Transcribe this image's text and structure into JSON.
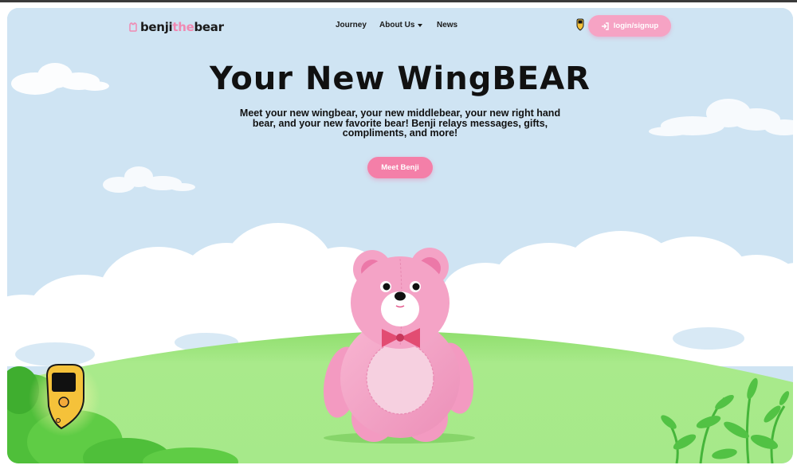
{
  "brand": {
    "logo_part1": "benji",
    "logo_part2": "the",
    "logo_part3": "bear"
  },
  "nav": {
    "items": [
      {
        "label": "Journey"
      },
      {
        "label": "About Us"
      },
      {
        "label": "News"
      }
    ]
  },
  "header": {
    "login_label": "login/signup"
  },
  "hero": {
    "title": "Your New WingBEAR",
    "subtitle": "Meet your new wingbear, your new middlebear, your new right hand bear, and your new favorite bear! Benji relays messages, gifts, compliments, and more!",
    "cta_label": "Meet Benji"
  },
  "colors": {
    "sky": "#cfe4f3",
    "brand_pink": "#f089b2",
    "button_pink": "#f47fa8",
    "login_pink": "#f6a3c4",
    "grass": "#a6e98a",
    "bear_pink": "#f4a3c6",
    "device_yellow": "#f5c23a"
  },
  "icons": {
    "logo": "bear-outline-icon",
    "login": "sign-in-icon",
    "dropdown": "caret-down-icon",
    "device": "benji-device-icon"
  }
}
